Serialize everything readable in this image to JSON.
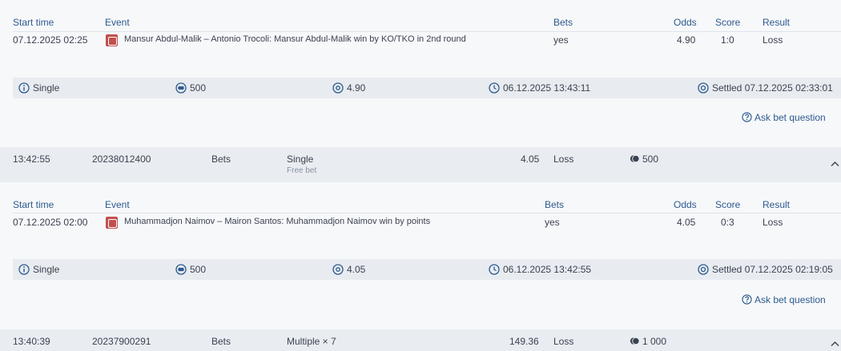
{
  "blocks": [
    {
      "headers": {
        "start_time": "Start time",
        "event": "Event",
        "bets": "Bets",
        "odds": "Odds",
        "score": "Score",
        "result": "Result"
      },
      "row": {
        "start_time": "07.12.2025 02:25",
        "event": "Mansur Abdul-Malik – Antonio Trocoli: Mansur Abdul-Malik win by KO/TKO in 2nd round",
        "bets": "yes",
        "odds": "4.90",
        "score": "1:0",
        "result": "Loss"
      },
      "info": {
        "type": "Single",
        "stake": "500",
        "odds": "4.90",
        "placed": "06.12.2025 13:43:11",
        "settled": "Settled 07.12.2025 02:33:01"
      },
      "ask": "Ask bet question"
    },
    {
      "headers": {
        "start_time": "Start time",
        "event": "Event",
        "bets": "Bets",
        "odds": "Odds",
        "score": "Score",
        "result": "Result"
      },
      "row": {
        "start_time": "07.12.2025 02:00",
        "event": "Muhammadjon Naimov – Mairon Santos: Muhammadjon Naimov win by points",
        "bets": "yes",
        "odds": "4.05",
        "score": "0:3",
        "result": "Loss"
      },
      "info": {
        "type": "Single",
        "stake": "500",
        "odds": "4.05",
        "placed": "06.12.2025 13:42:55",
        "settled": "Settled 07.12.2025 02:19:05"
      },
      "ask": "Ask bet question"
    }
  ],
  "summaries": [
    {
      "time": "13:42:55",
      "id": "20238012400",
      "category": "Bets",
      "type": "Single",
      "note": "Free bet",
      "odds": "4.05",
      "result": "Loss",
      "stake": "500"
    },
    {
      "time": "13:40:39",
      "id": "20237900291",
      "category": "Bets",
      "type": "Multiple × 7",
      "note": "",
      "odds": "149.36",
      "result": "Loss",
      "stake": "1 000"
    }
  ],
  "colors": {
    "header_text": "#2d5a8e",
    "info_bar": "#e8ecf1",
    "summary_bg": "#e9edf2",
    "event_icon": "#c0504d"
  },
  "icons": [
    "info-icon",
    "coins-icon",
    "at-icon",
    "clock-icon",
    "settled-icon",
    "question-icon",
    "chevron-up-icon",
    "sport-icon"
  ]
}
